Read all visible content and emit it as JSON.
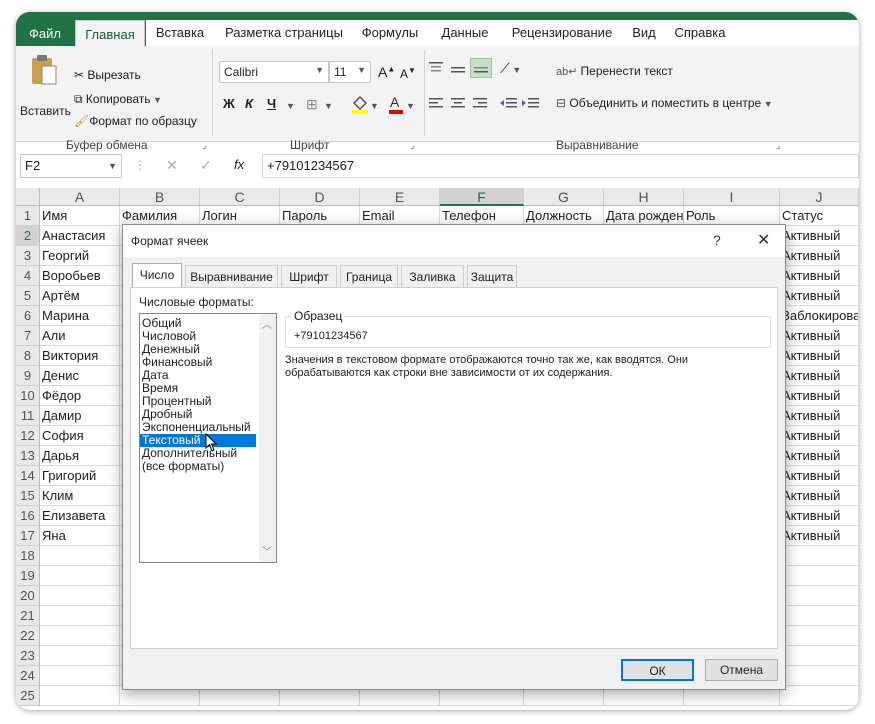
{
  "ribbon": {
    "tabs": [
      "Файл",
      "Главная",
      "Вставка",
      "Разметка страницы",
      "Формулы",
      "Данные",
      "Рецензирование",
      "Вид",
      "Справка"
    ],
    "clipboard": {
      "paste": "Вставить",
      "cut": "Вырезать",
      "copy": "Копировать",
      "format_painter": "Формат по образцу",
      "label": "Буфер обмена"
    },
    "font": {
      "name": "Calibri",
      "size": "11",
      "bold": "Ж",
      "italic": "К",
      "underline": "Ч",
      "label": "Шрифт",
      "grow": "A",
      "shrink": "A"
    },
    "alignment": {
      "wrap": "Перенести текст",
      "merge": "Объединить и поместить в центре",
      "label": "Выравнивание"
    }
  },
  "formula_bar": {
    "name_box": "F2",
    "fx": "fx",
    "value": "+79101234567"
  },
  "sheet": {
    "columns": [
      "A",
      "B",
      "C",
      "D",
      "E",
      "F",
      "G",
      "H",
      "I",
      "J"
    ],
    "header_row": [
      "Имя",
      "Фамилия",
      "Логин",
      "Пароль",
      "Email",
      "Телефон",
      "Должность",
      "Дата рождения",
      "Роль",
      "Статус"
    ],
    "names": [
      "Анастасия",
      "Георгий",
      "Воробьев",
      "Артём",
      "Марина",
      "Али",
      "Виктория",
      "Денис",
      "Фёдор",
      "Дамир",
      "София",
      "Дарья",
      "Григорий",
      "Клим",
      "Елизавета",
      "Яна"
    ],
    "statuses": [
      "Активный",
      "Активный",
      "Активный",
      "Активный",
      "Заблокирован",
      "Активный",
      "Активный",
      "Активный",
      "Активный",
      "Активный",
      "Активный",
      "Активный",
      "Активный",
      "Активный",
      "Активный",
      "Активный"
    ],
    "row_numbers": [
      "1",
      "2",
      "3",
      "4",
      "5",
      "6",
      "7",
      "8",
      "9",
      "10",
      "11",
      "12",
      "13",
      "14",
      "15",
      "16",
      "17",
      "18",
      "19",
      "20",
      "21",
      "22",
      "23",
      "24",
      "25"
    ]
  },
  "dialog": {
    "title": "Формат ячеек",
    "help": "?",
    "tabs": [
      "Число",
      "Выравнивание",
      "Шрифт",
      "Граница",
      "Заливка",
      "Защита"
    ],
    "formats_label": "Числовые форматы:",
    "formats": [
      "Общий",
      "Числовой",
      "Денежный",
      "Финансовый",
      "Дата",
      "Время",
      "Процентный",
      "Дробный",
      "Экспоненциальный",
      "Текстовый",
      "Дополнительный",
      "(все форматы)"
    ],
    "selected_format": "Текстовый",
    "sample_label": "Образец",
    "sample_value": "+79101234567",
    "description": "Значения в текстовом формате отображаются точно так же, как вводятся. Они обрабатываются как строки вне зависимости от их содержания.",
    "ok": "ОК",
    "cancel": "Отмена"
  },
  "colors": {
    "excel_green": "#217346",
    "selection_blue": "#0078d7"
  }
}
